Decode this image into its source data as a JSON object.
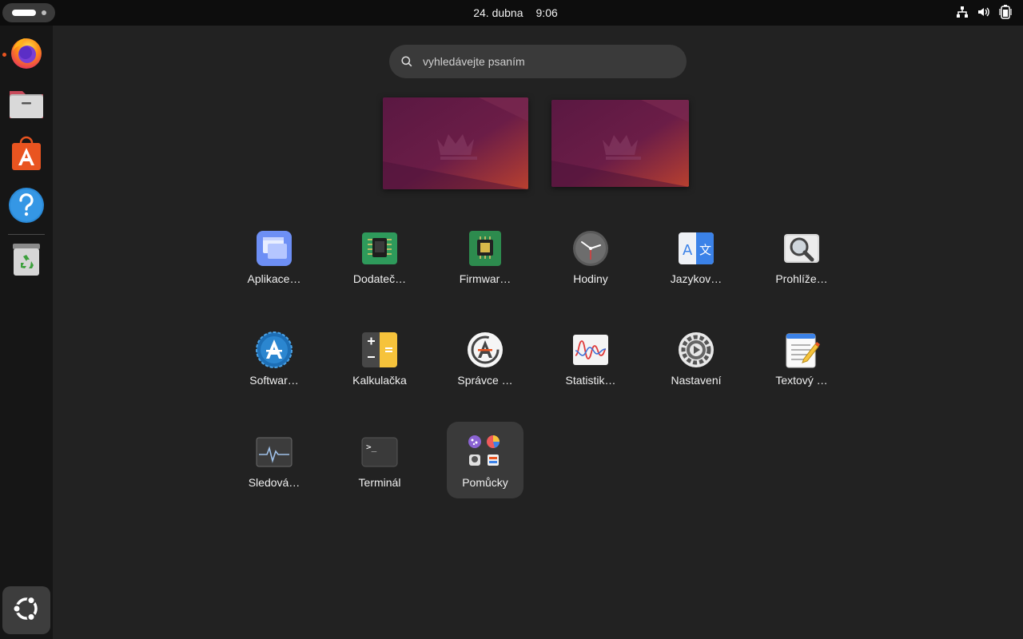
{
  "topbar": {
    "date": "24. dubna",
    "time": "9:06",
    "tray_icons": [
      "network-icon",
      "volume-icon",
      "battery-icon"
    ]
  },
  "dock": {
    "items": [
      {
        "name": "firefox",
        "icon": "firefox-icon",
        "running": true
      },
      {
        "name": "files",
        "icon": "files-icon",
        "running": false
      },
      {
        "name": "app-center",
        "icon": "app-center-icon",
        "running": false
      },
      {
        "name": "help",
        "icon": "help-icon",
        "running": false
      },
      {
        "name": "trash",
        "icon": "trash-icon",
        "running": false
      }
    ],
    "show_apps_icon": "ubuntu-logo-icon"
  },
  "search": {
    "placeholder": "vyhledávejte psaním"
  },
  "workspaces": {
    "count": 2
  },
  "apps": [
    {
      "label": "Aplikace…",
      "icon": "windows-app-icon"
    },
    {
      "label": "Dodateč…",
      "icon": "chip-green-icon"
    },
    {
      "label": "Firmwar…",
      "icon": "firmware-chip-icon"
    },
    {
      "label": "Hodiny",
      "icon": "clock-icon"
    },
    {
      "label": "Jazykov…",
      "icon": "language-icon"
    },
    {
      "label": "Prohlíže…",
      "icon": "magnifier-viewer-icon"
    },
    {
      "label": "Softwar…",
      "icon": "software-updater-icon"
    },
    {
      "label": "Kalkulačka",
      "icon": "calculator-icon"
    },
    {
      "label": "Správce …",
      "icon": "package-manager-icon"
    },
    {
      "label": "Statistik…",
      "icon": "statistics-chart-icon"
    },
    {
      "label": "Nastavení",
      "icon": "settings-gear-icon"
    },
    {
      "label": "Textový …",
      "icon": "text-editor-icon"
    },
    {
      "label": "Sledová…",
      "icon": "system-monitor-icon"
    },
    {
      "label": "Terminál",
      "icon": "terminal-icon"
    },
    {
      "label": "Pomůcky",
      "icon": "utilities-folder-icon"
    }
  ],
  "colors": {
    "background": "#222222",
    "topbar": "#0d0d0d",
    "dock": "#161616",
    "accent": "#e95420"
  }
}
